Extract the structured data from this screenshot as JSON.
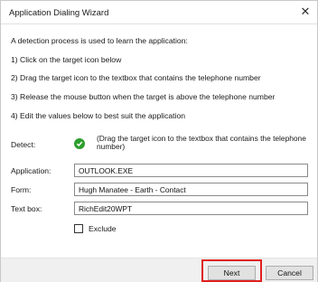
{
  "window": {
    "title": "Application Dialing Wizard",
    "close_glyph": "✕"
  },
  "instructions": {
    "intro": "A detection process is used to learn the application:",
    "steps": [
      "1) Click on the target icon below",
      "2) Drag the target icon to the textbox that contains the telephone number",
      "3) Release the mouse button when the target is above the telephone number",
      "4) Edit the values below to best suit the application"
    ]
  },
  "detect": {
    "label": "Detect:",
    "icon": "green-check-circle-icon",
    "text": "(Drag the target icon to the textbox that contains the telephone number)"
  },
  "fields": {
    "application": {
      "label": "Application:",
      "value": "OUTLOOK.EXE"
    },
    "form": {
      "label": "Form:",
      "value": "Hugh Manatee - Earth - Contact"
    },
    "textbox": {
      "label": "Text box:",
      "value": "RichEdit20WPT"
    }
  },
  "exclude": {
    "label": "Exclude",
    "checked": false
  },
  "buttons": {
    "next": "Next",
    "cancel": "Cancel"
  },
  "colors": {
    "highlight": "#e02020",
    "check_icon": "#2c9e2c"
  }
}
